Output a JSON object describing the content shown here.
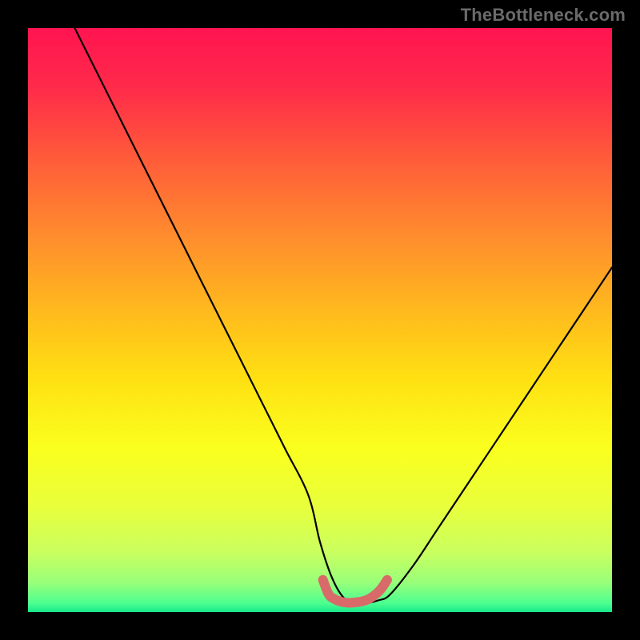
{
  "watermark": "TheBottleneck.com",
  "chart_data": {
    "type": "line",
    "title": "",
    "xlabel": "",
    "ylabel": "",
    "xlim": [
      0,
      100
    ],
    "ylim": [
      0,
      100
    ],
    "series": [
      {
        "name": "bottleneck-curve",
        "x": [
          8,
          12,
          16,
          20,
          24,
          28,
          32,
          36,
          40,
          44,
          48,
          50,
          52,
          54,
          56,
          58,
          60,
          62,
          66,
          70,
          74,
          78,
          82,
          86,
          90,
          94,
          98,
          100
        ],
        "values": [
          100,
          92,
          84,
          76,
          68,
          60,
          52,
          44,
          36,
          28,
          20,
          12,
          6,
          2.5,
          1.5,
          1.5,
          2,
          3,
          8,
          14,
          20,
          26,
          32,
          38,
          44,
          50,
          56,
          59
        ]
      },
      {
        "name": "optimal-band",
        "x": [
          50.5,
          51.5,
          52.5,
          53.5,
          54.5,
          55.5,
          56.5,
          57.5,
          58.5,
          59.5,
          60.5,
          61.5
        ],
        "values": [
          5.5,
          3.0,
          2.2,
          1.8,
          1.6,
          1.6,
          1.7,
          1.9,
          2.3,
          3.0,
          4.0,
          5.5
        ]
      }
    ],
    "gradient_stops": [
      {
        "pos": 0.0,
        "color": "#ff1450"
      },
      {
        "pos": 0.1,
        "color": "#ff2a4a"
      },
      {
        "pos": 0.22,
        "color": "#ff5a3a"
      },
      {
        "pos": 0.35,
        "color": "#ff8a2e"
      },
      {
        "pos": 0.48,
        "color": "#ffb81e"
      },
      {
        "pos": 0.6,
        "color": "#ffe012"
      },
      {
        "pos": 0.72,
        "color": "#faff1e"
      },
      {
        "pos": 0.82,
        "color": "#e8ff3c"
      },
      {
        "pos": 0.9,
        "color": "#c8ff60"
      },
      {
        "pos": 0.95,
        "color": "#98ff7a"
      },
      {
        "pos": 0.985,
        "color": "#4cff90"
      },
      {
        "pos": 1.0,
        "color": "#18e88a"
      }
    ],
    "curve_color": "#000000",
    "band_color": "#d86a6a"
  }
}
